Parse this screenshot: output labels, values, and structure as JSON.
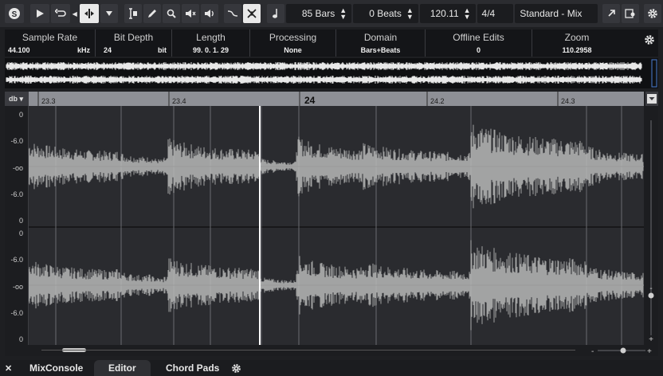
{
  "toolbar": {
    "bars_value": "85 Bars",
    "beats_value": "0 Beats",
    "tempo_value": "120.11",
    "signature_value": "4/4",
    "preset_value": "Standard - Mix"
  },
  "info": {
    "columns": [
      {
        "label": "Sample Rate",
        "value": "44.100",
        "unit": "kHz"
      },
      {
        "label": "Bit Depth",
        "value": "24",
        "unit": "bit"
      },
      {
        "label": "Length",
        "value": "99. 0. 1. 29"
      },
      {
        "label": "Processing",
        "value": "None"
      },
      {
        "label": "Domain",
        "value": "Bars+Beats"
      },
      {
        "label": "Offline Edits",
        "value": "0"
      },
      {
        "label": "Zoom",
        "value": "110.2958"
      }
    ]
  },
  "ruler": {
    "unit_label": "db",
    "marks": [
      "23.3",
      "23.4",
      "24",
      "24.2",
      "24.3"
    ]
  },
  "scale": {
    "labels": [
      "0",
      "-6.0",
      "-oo",
      "-6.0",
      "0",
      "0",
      "-6.0",
      "-oo",
      "-6.0",
      "0"
    ]
  },
  "tabs": {
    "close_glyph": "✕",
    "items": [
      "MixConsole",
      "Editor",
      "Chord Pads"
    ]
  },
  "colors": {
    "accent_white": "#e9e9e9",
    "waveform": "#b8b8b8",
    "background": "#1e1f22"
  }
}
